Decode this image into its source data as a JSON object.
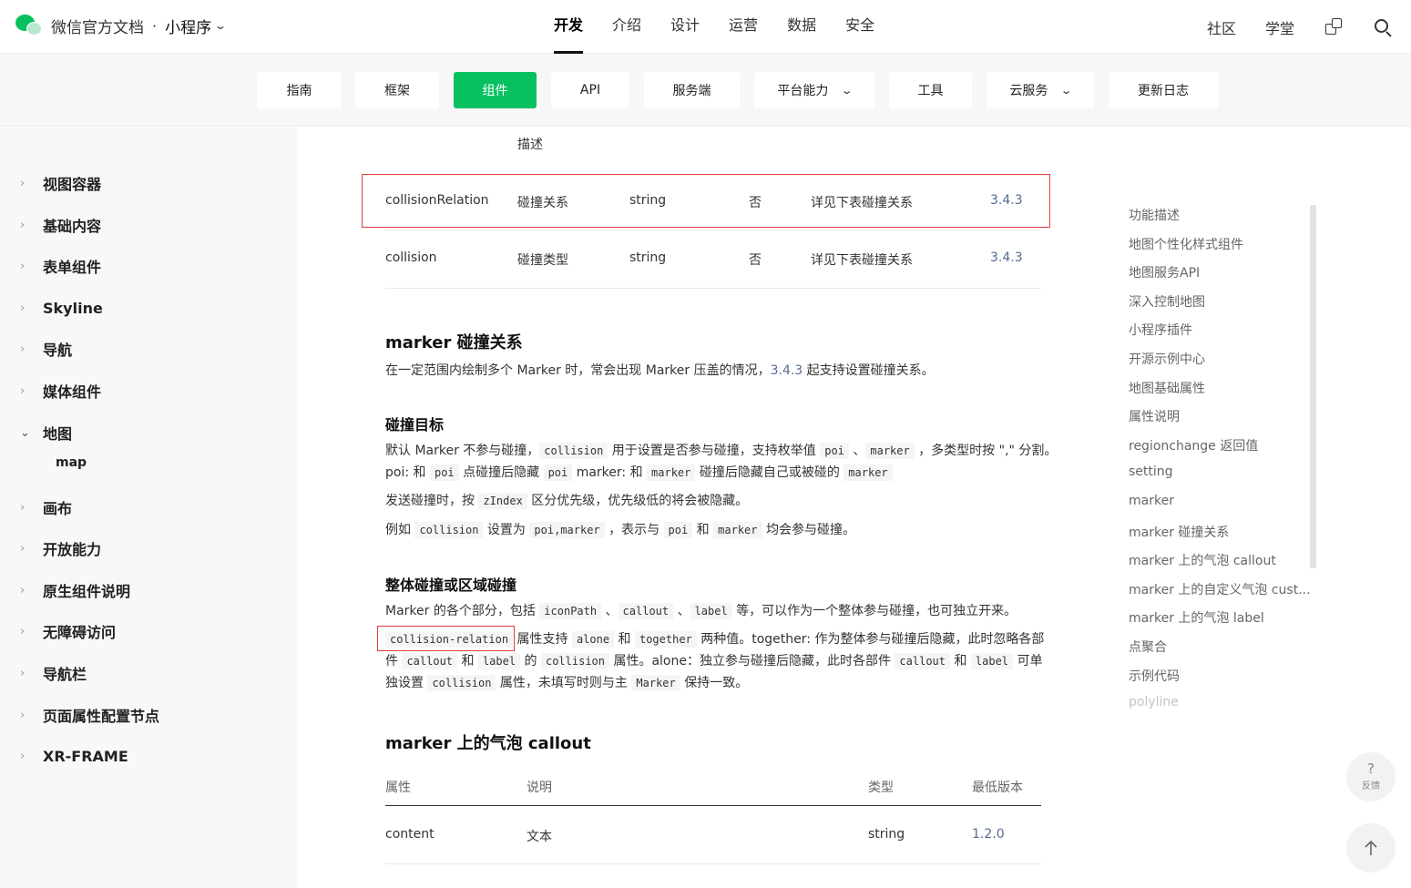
{
  "header": {
    "site_title": "微信官方文档",
    "separator": "·",
    "product": "小程序",
    "product_chevron": "chevron-down-icon",
    "nav": [
      {
        "label": "开发",
        "active": true
      },
      {
        "label": "介绍",
        "active": false
      },
      {
        "label": "设计",
        "active": false
      },
      {
        "label": "运营",
        "active": false
      },
      {
        "label": "数据",
        "active": false
      },
      {
        "label": "安全",
        "active": false
      }
    ],
    "right_links": [
      "社区",
      "学堂"
    ],
    "icons": [
      "blocks-icon",
      "search-icon"
    ]
  },
  "subnav": [
    {
      "label": "指南",
      "active": false,
      "dropdown": false
    },
    {
      "label": "框架",
      "active": false,
      "dropdown": false
    },
    {
      "label": "组件",
      "active": true,
      "dropdown": false
    },
    {
      "label": "API",
      "active": false,
      "dropdown": false
    },
    {
      "label": "服务端",
      "active": false,
      "dropdown": false
    },
    {
      "label": "平台能力",
      "active": false,
      "dropdown": true
    },
    {
      "label": "工具",
      "active": false,
      "dropdown": false
    },
    {
      "label": "云服务",
      "active": false,
      "dropdown": true
    },
    {
      "label": "更新日志",
      "active": false,
      "dropdown": false
    }
  ],
  "sidebar": {
    "items": [
      {
        "label": "视图容器",
        "open": false
      },
      {
        "label": "基础内容",
        "open": false
      },
      {
        "label": "表单组件",
        "open": false
      },
      {
        "label": "Skyline",
        "open": false
      },
      {
        "label": "导航",
        "open": false
      },
      {
        "label": "媒体组件",
        "open": false
      },
      {
        "label": "地图",
        "open": true
      },
      {
        "label": "画布",
        "open": false
      },
      {
        "label": "开放能力",
        "open": false
      },
      {
        "label": "原生组件说明",
        "open": false
      },
      {
        "label": "无障碍访问",
        "open": false
      },
      {
        "label": "导航栏",
        "open": false
      },
      {
        "label": "页面属性配置节点",
        "open": false
      },
      {
        "label": "XR-FRAME",
        "open": false
      }
    ],
    "sub_item": "map"
  },
  "content": {
    "top_fragment": "描述",
    "rows": [
      {
        "prop": "collisionRelation",
        "desc": "碰撞关系",
        "type": "string",
        "required": "否",
        "default": "详见下表碰撞关系",
        "version": "3.4.3"
      },
      {
        "prop": "collision",
        "desc": "碰撞类型",
        "type": "string",
        "required": "否",
        "default": "详见下表碰撞关系",
        "version": "3.4.3"
      }
    ],
    "section1": {
      "title": "marker 碰撞关系",
      "para_a": "在一定范围内绘制多个 Marker 时，常会出现 Marker 压盖的情况，",
      "para_link": "3.4.3",
      "para_b": " 起支持设置碰撞关系。"
    },
    "section2": {
      "title": "碰撞目标",
      "l1": [
        "默认 Marker 不参与碰撞，",
        "collision",
        " 用于设置是否参与碰撞，支持枚举值 ",
        "poi",
        " 、",
        "marker",
        " ，多类型时按 \",\" 分割。"
      ],
      "l2": [
        "poi: 和 ",
        "poi",
        " 点碰撞后隐藏 ",
        "poi",
        " marker: 和 ",
        "marker",
        " 碰撞后隐藏自己或被碰的 ",
        "marker"
      ],
      "l3": [
        "发送碰撞时，按 ",
        "zIndex",
        " 区分优先级，优先级低的将会被隐藏。"
      ],
      "l4": [
        "例如 ",
        "collision",
        " 设置为 ",
        "poi,marker",
        " ，表示与 ",
        "poi",
        " 和 ",
        "marker",
        " 均会参与碰撞。"
      ]
    },
    "section3": {
      "title": "整体碰撞或区域碰撞",
      "l1": [
        "Marker 的各个部分，包括 ",
        "iconPath",
        " 、",
        "callout",
        " 、",
        "label",
        " 等，可以作为一个整体参与碰撞，也可独立开来。"
      ],
      "l2": [
        "collision-relation",
        " 属性支持 ",
        "alone",
        " 和 ",
        "together",
        " 两种值。together: 作为整体参与碰撞后隐藏，此时忽略各部"
      ],
      "l3": [
        "件 ",
        "callout",
        " 和 ",
        "label",
        " 的 ",
        "collision",
        " 属性。alone：独立参与碰撞后隐藏，此时各部件 ",
        "callout",
        " 和 ",
        "label",
        " 可单"
      ],
      "l4": [
        "独设置 ",
        "collision",
        " 属性，未填写时则与主 ",
        "Marker",
        " 保持一致。"
      ]
    },
    "section4": {
      "title": "marker 上的气泡 callout",
      "headers": [
        "属性",
        "说明",
        "类型",
        "最低版本"
      ],
      "row": {
        "prop": "content",
        "desc": "文本",
        "type": "string",
        "version": "1.2.0"
      }
    }
  },
  "toc": [
    {
      "label": "功能描述",
      "faded": false
    },
    {
      "label": "地图个性化样式组件",
      "faded": false
    },
    {
      "label": "地图服务API",
      "faded": false
    },
    {
      "label": "深入控制地图",
      "faded": false
    },
    {
      "label": "小程序插件",
      "faded": false
    },
    {
      "label": "开源示例中心",
      "faded": false
    },
    {
      "label": "地图基础属性",
      "faded": false
    },
    {
      "label": "属性说明",
      "faded": false
    },
    {
      "label": "regionchange 返回值",
      "faded": false
    },
    {
      "label": "setting",
      "faded": false
    },
    {
      "label": "marker",
      "faded": false
    },
    {
      "label": "marker 碰撞关系",
      "faded": false
    },
    {
      "label": "marker 上的气泡 callout",
      "faded": false
    },
    {
      "label": "marker 上的自定义气泡 cust...",
      "faded": false
    },
    {
      "label": "marker 上的气泡 label",
      "faded": false
    },
    {
      "label": "点聚合",
      "faded": false
    },
    {
      "label": "示例代码",
      "faded": false
    },
    {
      "label": "polyline",
      "faded": true
    }
  ],
  "fab": {
    "feedback_symbol": "?",
    "feedback_label": "反馈",
    "feedback_icon": "question-icon",
    "top_icon": "arrow-up-icon"
  },
  "colors": {
    "accent": "#07c160",
    "link": "#576b95",
    "highlight_box": "#e23b3b"
  }
}
